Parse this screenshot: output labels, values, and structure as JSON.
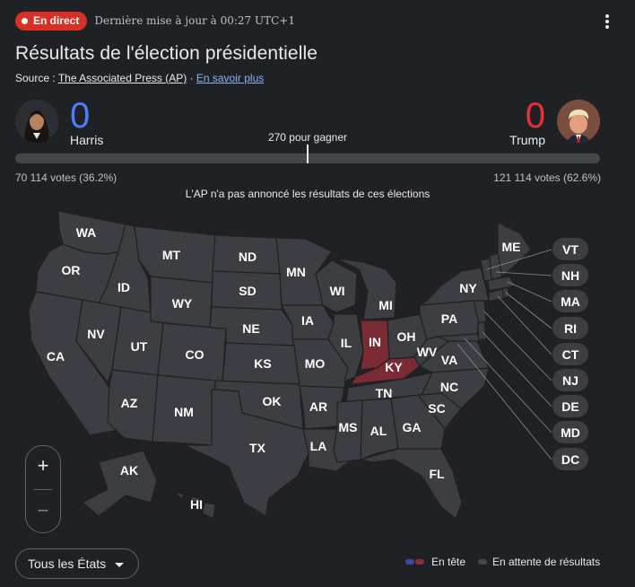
{
  "header": {
    "live_label": "En direct",
    "updated_text": "Dernière mise à jour à 00:27 UTC+1",
    "menu_icon": "more-vert-icon"
  },
  "title": "Résultats de l'élection présidentielle",
  "source": {
    "prefix": "Source : ",
    "name": "The Associated Press (AP)",
    "separator": " · ",
    "learn_more": "En savoir plus"
  },
  "candidates": {
    "harris": {
      "name": "Harris",
      "electoral_votes": "0",
      "votes_text": "70 114 votes (36.2%)",
      "color": "#4f7df9"
    },
    "trump": {
      "name": "Trump",
      "electoral_votes": "0",
      "votes_text": "121 114 votes (62.6%)",
      "color": "#e0323d"
    }
  },
  "to_win": "270 pour gagner",
  "ap_note": "L'AP n'a pas annoncé les résultats de ces élections",
  "map": {
    "colors": {
      "pending": "#3c3e44",
      "gop_leading": "#7a2b33",
      "border": "#202124"
    },
    "states": [
      "WA",
      "OR",
      "CA",
      "ID",
      "NV",
      "MT",
      "WY",
      "UT",
      "AZ",
      "CO",
      "NM",
      "ND",
      "SD",
      "NE",
      "KS",
      "OK",
      "TX",
      "MN",
      "IA",
      "MO",
      "AR",
      "LA",
      "WI",
      "IL",
      "MI",
      "IN",
      "OH",
      "KY",
      "TN",
      "MS",
      "AL",
      "GA",
      "FL",
      "SC",
      "NC",
      "VA",
      "WV",
      "PA",
      "NY",
      "ME",
      "AK",
      "HI"
    ],
    "leading_states": [
      "IN",
      "KY"
    ],
    "callouts": [
      "VT",
      "NH",
      "MA",
      "RI",
      "CT",
      "NJ",
      "DE",
      "MD",
      "DC"
    ]
  },
  "zoom": {
    "in": "+",
    "out": "−"
  },
  "filter": {
    "selected": "Tous les États"
  },
  "legend": {
    "leading": "En tête",
    "pending": "En attente de résultats",
    "colors": {
      "dem": "#3a4a9c",
      "gop": "#8c2f39",
      "pending": "#44464d"
    }
  }
}
